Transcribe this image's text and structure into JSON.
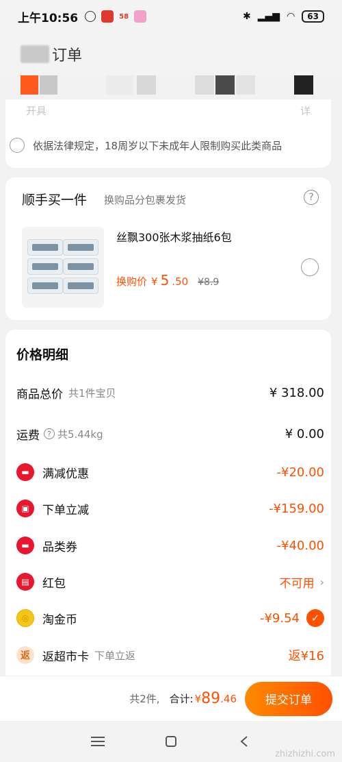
{
  "status_bar": {
    "time": "上午10:56",
    "badge": "58",
    "battery": "63"
  },
  "header": {
    "title": "订单"
  },
  "legal": {
    "faded_left": "开具",
    "faded_right": "详",
    "text": "依据法律规定，18周岁以下未成年人限制购买此类商品"
  },
  "addon": {
    "title": "顺手买一件",
    "subtitle": "换购品分包裹发货",
    "product_name": "丝飘300张木浆抽纸6包",
    "price_label": "换购价",
    "price_yen": "¥",
    "price_int": "5",
    "price_dec": ".50",
    "old_price": "¥8.9"
  },
  "price_detail": {
    "title": "价格明细",
    "rows": [
      {
        "label": "商品总价",
        "sub": "共1件宝贝",
        "value": "¥ 318.00"
      },
      {
        "label": "运费",
        "sub": "共5.44kg",
        "value": "¥ 0.00"
      },
      {
        "label": "满减优惠",
        "value": "-¥20.00"
      },
      {
        "label": "下单立减",
        "value": "-¥159.00"
      },
      {
        "label": "品类券",
        "value": "-¥40.00"
      },
      {
        "label": "红包",
        "value": "不可用"
      },
      {
        "label": "淘金币",
        "value": "-¥9.54"
      },
      {
        "label": "返超市卡",
        "sub": "下单立返",
        "value": "返¥16",
        "icon_char": "返"
      }
    ]
  },
  "bottom": {
    "count": "共2件,",
    "total_label": "合计:",
    "total_yen": "¥",
    "total_int": "89",
    "total_dec": ".46",
    "submit": "提交订单"
  },
  "watermark": "zhizhizhi.com",
  "colors": {
    "accent": "#ff5000",
    "red_icon": "#e8162f",
    "gold_icon": "#f5c518"
  }
}
